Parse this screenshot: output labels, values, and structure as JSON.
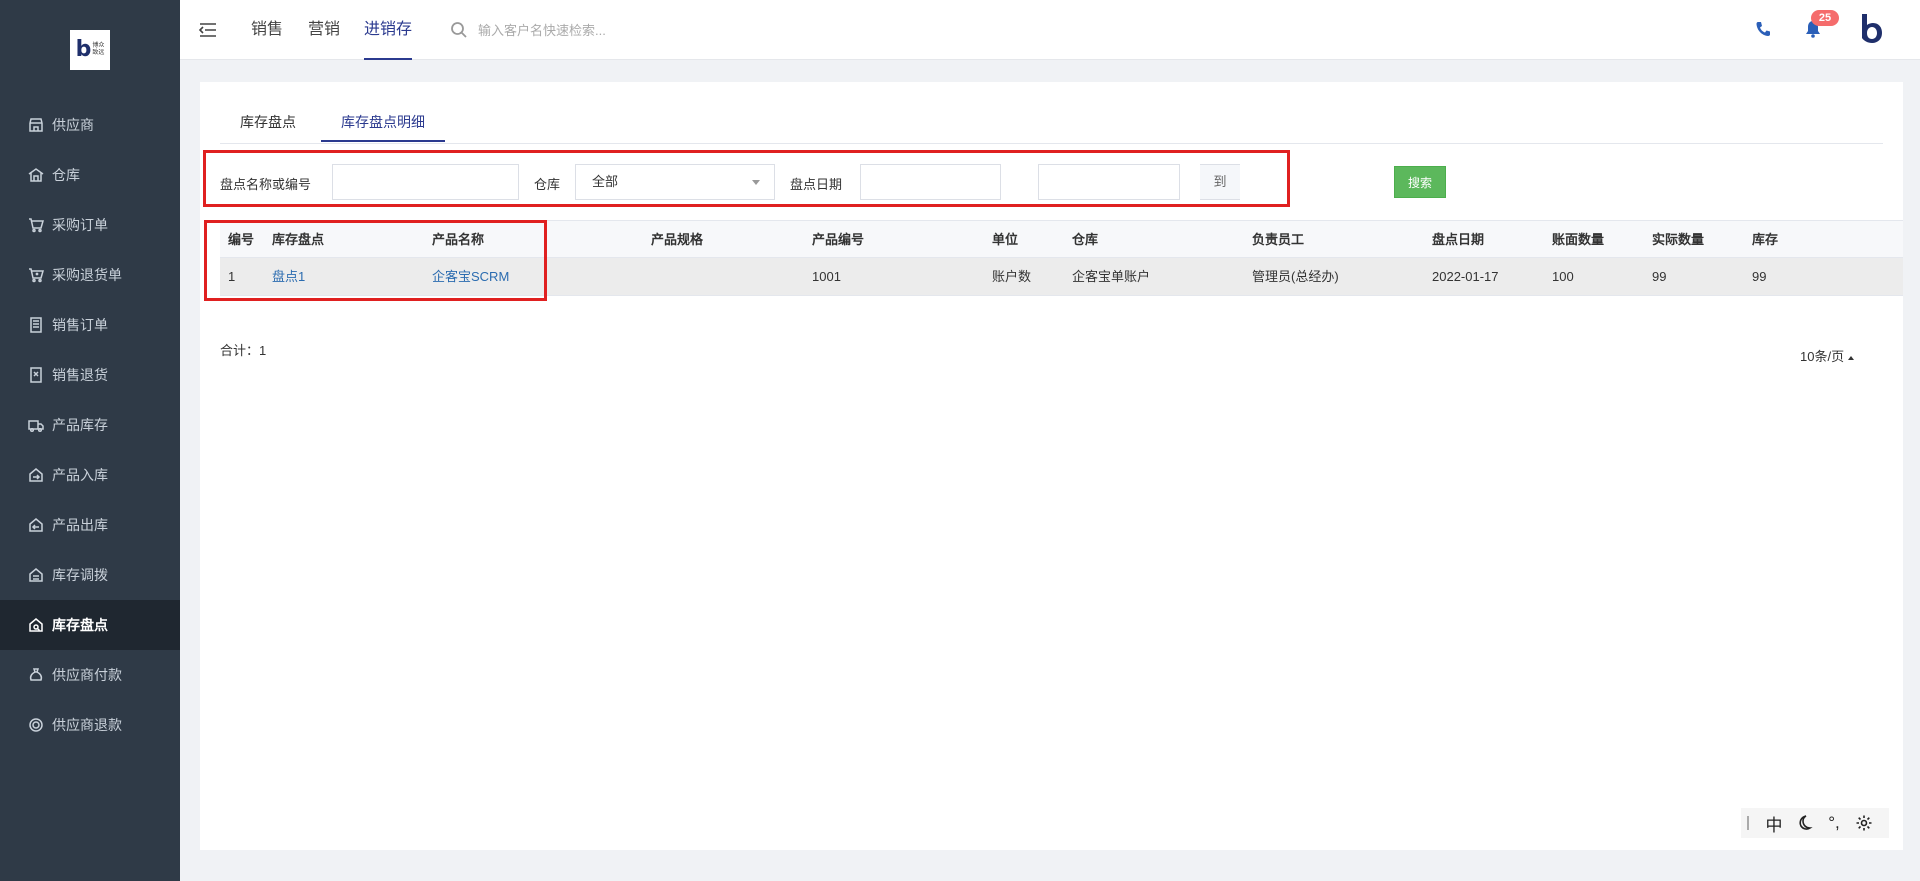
{
  "logo": {
    "mark": "b",
    "text_line1": "博众",
    "text_line2": "致远"
  },
  "sidebar": {
    "items": [
      {
        "label": "供应商",
        "icon": "store-icon"
      },
      {
        "label": "仓库",
        "icon": "warehouse-icon"
      },
      {
        "label": "采购订单",
        "icon": "cart-icon"
      },
      {
        "label": "采购退货单",
        "icon": "cart-return-icon"
      },
      {
        "label": "销售订单",
        "icon": "order-list-icon"
      },
      {
        "label": "销售退货",
        "icon": "sales-return-icon"
      },
      {
        "label": "产品库存",
        "icon": "truck-icon"
      },
      {
        "label": "产品入库",
        "icon": "stock-in-icon"
      },
      {
        "label": "产品出库",
        "icon": "stock-out-icon"
      },
      {
        "label": "库存调拨",
        "icon": "transfer-icon"
      },
      {
        "label": "库存盘点",
        "icon": "inventory-check-icon",
        "active": true
      },
      {
        "label": "供应商付款",
        "icon": "money-bag-icon"
      },
      {
        "label": "供应商退款",
        "icon": "refund-icon"
      }
    ]
  },
  "header": {
    "tabs": [
      "销售",
      "营销",
      "进销存"
    ],
    "active_tab": "进销存",
    "search_placeholder": "输入客户名快速检索...",
    "notification_count": "25",
    "accent_color": "#2b3a8f"
  },
  "page": {
    "tabs": [
      "库存盘点",
      "库存盘点明细"
    ],
    "active_tab": "库存盘点明细",
    "filters": {
      "name_label": "盘点名称或编号",
      "name_value": "",
      "warehouse_label": "仓库",
      "warehouse_value": "全部",
      "date_label": "盘点日期",
      "date_from": "",
      "date_sep": "到",
      "date_to": "",
      "search_button": "搜索"
    },
    "table": {
      "columns": [
        "编号",
        "库存盘点",
        "产品名称",
        "产品规格",
        "产品编号",
        "单位",
        "仓库",
        "负责员工",
        "盘点日期",
        "账面数量",
        "实际数量",
        "库存"
      ],
      "rows": [
        [
          "1",
          "盘点1",
          "企客宝SCRM",
          "",
          "1001",
          "账户数",
          "企客宝单账户",
          "管理员(总经办)",
          "2022-01-17",
          "100",
          "99",
          "99"
        ]
      ]
    },
    "total": "合计：1",
    "page_size": "10条/页"
  },
  "ime": {
    "mode": "中",
    "punct": "°,"
  }
}
